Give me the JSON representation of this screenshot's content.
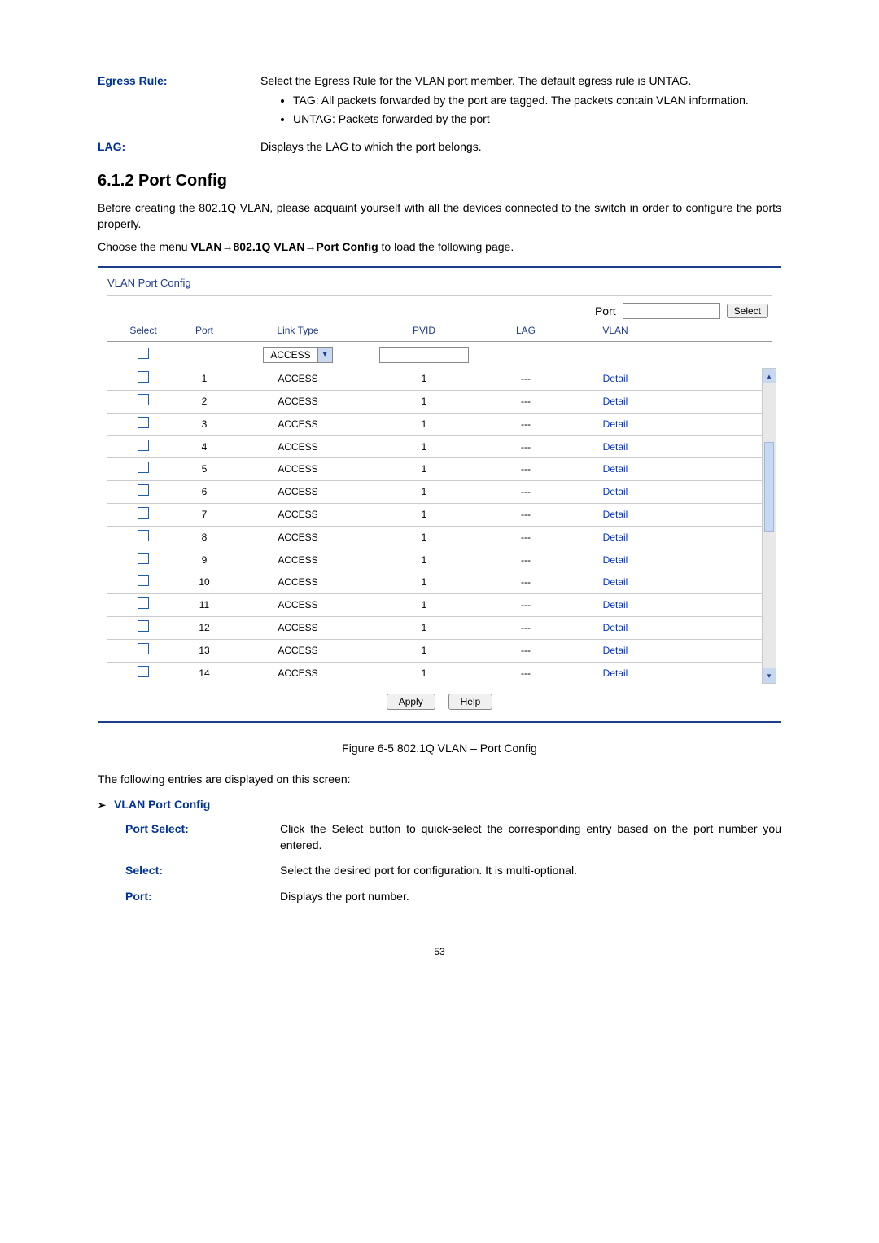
{
  "top_defs": {
    "egress_label": "Egress Rule:",
    "egress_text": "Select the Egress Rule for the VLAN port member. The default egress rule is UNTAG.",
    "egress_bullets": [
      "TAG: All packets forwarded by the port are tagged. The packets contain VLAN information.",
      "UNTAG: Packets forwarded by the port"
    ],
    "lag_label": "LAG:",
    "lag_text": "Displays the LAG to which the port belongs."
  },
  "section_hdr": "6.1.2 Port Config",
  "para1": "Before creating the 802.1Q VLAN, please acquaint yourself with all the devices connected to the switch in order to configure the ports properly.",
  "para2_pre": "Choose the menu ",
  "para2_bold": "VLAN→802.1Q VLAN→Port Config",
  "para2_post": " to load the following page.",
  "panel": {
    "title": "VLAN Port Config",
    "port_label": "Port",
    "select_btn": "Select",
    "headers": {
      "select": "Select",
      "port": "Port",
      "linktype": "Link Type",
      "pvid": "PVID",
      "lag": "LAG",
      "vlan": "VLAN"
    },
    "dropdown_value": "ACCESS",
    "rows": [
      {
        "port": "1",
        "linktype": "ACCESS",
        "pvid": "1",
        "lag": "---",
        "vlan": "Detail"
      },
      {
        "port": "2",
        "linktype": "ACCESS",
        "pvid": "1",
        "lag": "---",
        "vlan": "Detail"
      },
      {
        "port": "3",
        "linktype": "ACCESS",
        "pvid": "1",
        "lag": "---",
        "vlan": "Detail"
      },
      {
        "port": "4",
        "linktype": "ACCESS",
        "pvid": "1",
        "lag": "---",
        "vlan": "Detail"
      },
      {
        "port": "5",
        "linktype": "ACCESS",
        "pvid": "1",
        "lag": "---",
        "vlan": "Detail"
      },
      {
        "port": "6",
        "linktype": "ACCESS",
        "pvid": "1",
        "lag": "---",
        "vlan": "Detail"
      },
      {
        "port": "7",
        "linktype": "ACCESS",
        "pvid": "1",
        "lag": "---",
        "vlan": "Detail"
      },
      {
        "port": "8",
        "linktype": "ACCESS",
        "pvid": "1",
        "lag": "---",
        "vlan": "Detail"
      },
      {
        "port": "9",
        "linktype": "ACCESS",
        "pvid": "1",
        "lag": "---",
        "vlan": "Detail"
      },
      {
        "port": "10",
        "linktype": "ACCESS",
        "pvid": "1",
        "lag": "---",
        "vlan": "Detail"
      },
      {
        "port": "11",
        "linktype": "ACCESS",
        "pvid": "1",
        "lag": "---",
        "vlan": "Detail"
      },
      {
        "port": "12",
        "linktype": "ACCESS",
        "pvid": "1",
        "lag": "---",
        "vlan": "Detail"
      },
      {
        "port": "13",
        "linktype": "ACCESS",
        "pvid": "1",
        "lag": "---",
        "vlan": "Detail"
      },
      {
        "port": "14",
        "linktype": "ACCESS",
        "pvid": "1",
        "lag": "---",
        "vlan": "Detail"
      }
    ],
    "apply_btn": "Apply",
    "help_btn": "Help"
  },
  "figure_caption": "Figure 6-5 802.1Q VLAN – Port Config",
  "para3": "The following entries are displayed on this screen:",
  "sub_header": "VLAN Port Config",
  "bottom_defs": {
    "portselect_label": "Port Select:",
    "portselect_text": "Click the Select button to quick-select the corresponding entry based on the port number you entered.",
    "select_label": "Select:",
    "select_text": "Select the desired port for configuration. It is multi-optional.",
    "port_label": "Port:",
    "port_text": "Displays the port number."
  },
  "page_number": "53"
}
